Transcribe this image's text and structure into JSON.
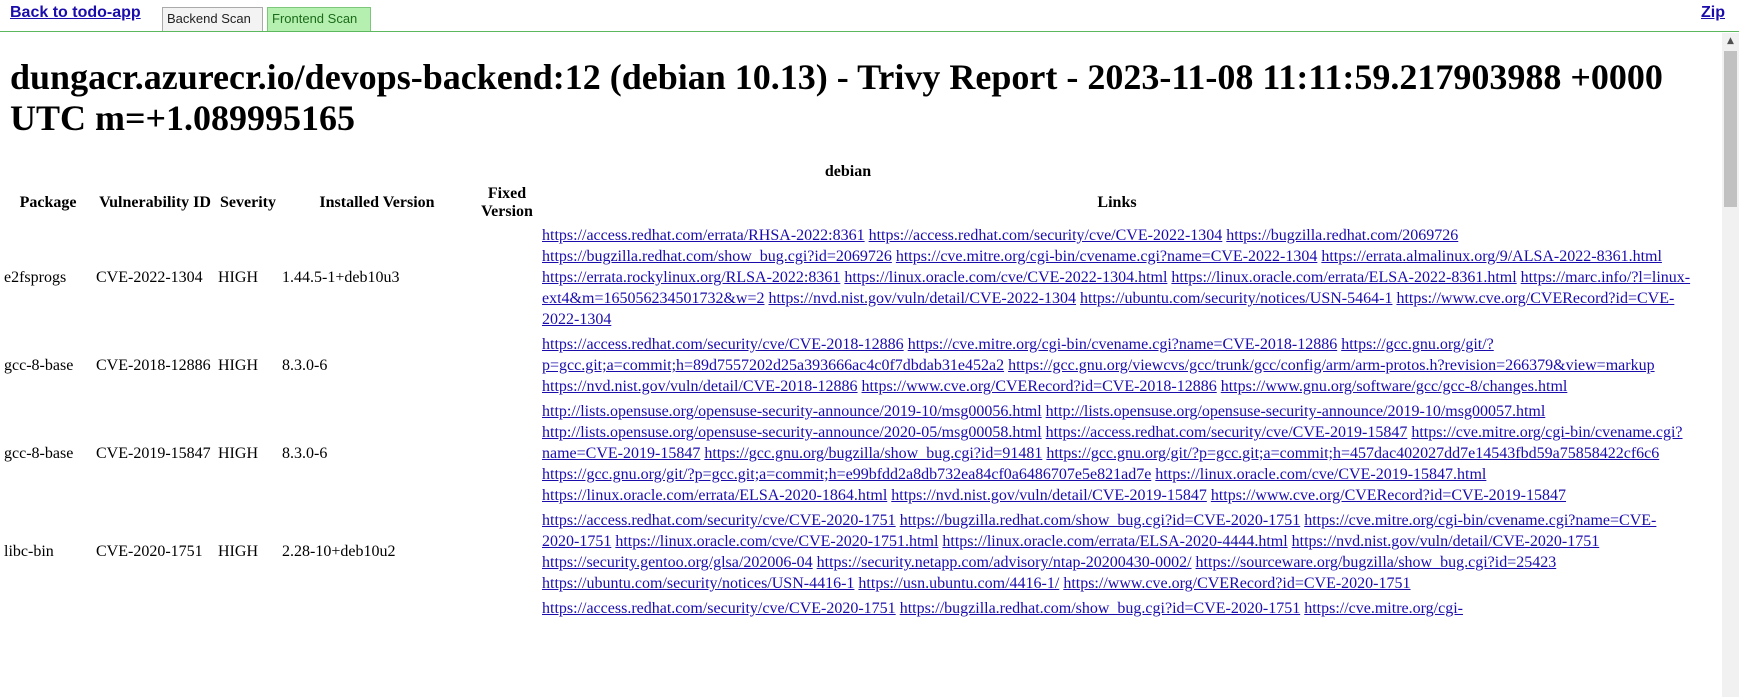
{
  "nav": {
    "back_label": "Back to todo-app",
    "tabs": [
      {
        "label": "Backend Scan",
        "active": false
      },
      {
        "label": "Frontend Scan",
        "active": true
      }
    ],
    "zip_label": "Zip"
  },
  "page_title": "dungacr.azurecr.io/devops-backend:12 (debian 10.13) - Trivy Report - 2023-11-08 11:11:59.217903988 +0000 UTC m=+1.089995165",
  "table": {
    "group_header": "debian",
    "headers": [
      "Package",
      "Vulnerability ID",
      "Severity",
      "Installed Version",
      "Fixed Version",
      "Links"
    ],
    "rows": [
      {
        "package": "e2fsprogs",
        "vuln_id": "CVE-2022-1304",
        "severity": "HIGH",
        "installed": "1.44.5-1+deb10u3",
        "fixed": "",
        "links": [
          "https://access.redhat.com/errata/RHSA-2022:8361",
          "https://access.redhat.com/security/cve/CVE-2022-1304",
          "https://bugzilla.redhat.com/2069726",
          "https://bugzilla.redhat.com/show_bug.cgi?id=2069726",
          "https://cve.mitre.org/cgi-bin/cvename.cgi?name=CVE-2022-1304",
          "https://errata.almalinux.org/9/ALSA-2022-8361.html",
          "https://errata.rockylinux.org/RLSA-2022:8361",
          "https://linux.oracle.com/cve/CVE-2022-1304.html",
          "https://linux.oracle.com/errata/ELSA-2022-8361.html",
          "https://marc.info/?l=linux-ext4&m=165056234501732&w=2",
          "https://nvd.nist.gov/vuln/detail/CVE-2022-1304",
          "https://ubuntu.com/security/notices/USN-5464-1",
          "https://www.cve.org/CVERecord?id=CVE-2022-1304"
        ]
      },
      {
        "package": "gcc-8-base",
        "vuln_id": "CVE-2018-12886",
        "severity": "HIGH",
        "installed": "8.3.0-6",
        "fixed": "",
        "links": [
          "https://access.redhat.com/security/cve/CVE-2018-12886",
          "https://cve.mitre.org/cgi-bin/cvename.cgi?name=CVE-2018-12886",
          "https://gcc.gnu.org/git/?p=gcc.git;a=commit;h=89d7557202d25a393666ac4c0f7dbdab31e452a2",
          "https://gcc.gnu.org/viewcvs/gcc/trunk/gcc/config/arm/arm-protos.h?revision=266379&view=markup",
          "https://nvd.nist.gov/vuln/detail/CVE-2018-12886",
          "https://www.cve.org/CVERecord?id=CVE-2018-12886",
          "https://www.gnu.org/software/gcc/gcc-8/changes.html"
        ]
      },
      {
        "package": "gcc-8-base",
        "vuln_id": "CVE-2019-15847",
        "severity": "HIGH",
        "installed": "8.3.0-6",
        "fixed": "",
        "links": [
          "http://lists.opensuse.org/opensuse-security-announce/2019-10/msg00056.html",
          "http://lists.opensuse.org/opensuse-security-announce/2019-10/msg00057.html",
          "http://lists.opensuse.org/opensuse-security-announce/2020-05/msg00058.html",
          "https://access.redhat.com/security/cve/CVE-2019-15847",
          "https://cve.mitre.org/cgi-bin/cvename.cgi?name=CVE-2019-15847",
          "https://gcc.gnu.org/bugzilla/show_bug.cgi?id=91481",
          "https://gcc.gnu.org/git/?p=gcc.git;a=commit;h=457dac402027dd7e14543fbd59a75858422cf6c6",
          "https://gcc.gnu.org/git/?p=gcc.git;a=commit;h=e99bfdd2a8db732ea84cf0a6486707e5e821ad7e",
          "https://linux.oracle.com/cve/CVE-2019-15847.html",
          "https://linux.oracle.com/errata/ELSA-2020-1864.html",
          "https://nvd.nist.gov/vuln/detail/CVE-2019-15847",
          "https://www.cve.org/CVERecord?id=CVE-2019-15847"
        ]
      },
      {
        "package": "libc-bin",
        "vuln_id": "CVE-2020-1751",
        "severity": "HIGH",
        "installed": "2.28-10+deb10u2",
        "fixed": "",
        "links": [
          "https://access.redhat.com/security/cve/CVE-2020-1751",
          "https://bugzilla.redhat.com/show_bug.cgi?id=CVE-2020-1751",
          "https://cve.mitre.org/cgi-bin/cvename.cgi?name=CVE-2020-1751",
          "https://linux.oracle.com/cve/CVE-2020-1751.html",
          "https://linux.oracle.com/errata/ELSA-2020-4444.html",
          "https://nvd.nist.gov/vuln/detail/CVE-2020-1751",
          "https://security.gentoo.org/glsa/202006-04",
          "https://security.netapp.com/advisory/ntap-20200430-0002/",
          "https://sourceware.org/bugzilla/show_bug.cgi?id=25423",
          "https://ubuntu.com/security/notices/USN-4416-1",
          "https://usn.ubuntu.com/4416-1/",
          "https://www.cve.org/CVERecord?id=CVE-2020-1751"
        ]
      },
      {
        "package": "",
        "vuln_id": "",
        "severity": "",
        "installed": "",
        "fixed": "",
        "links": [
          "https://access.redhat.com/security/cve/CVE-2020-1751",
          "https://bugzilla.redhat.com/show_bug.cgi?id=CVE-2020-1751",
          "https://cve.mitre.org/cgi-"
        ]
      }
    ]
  }
}
